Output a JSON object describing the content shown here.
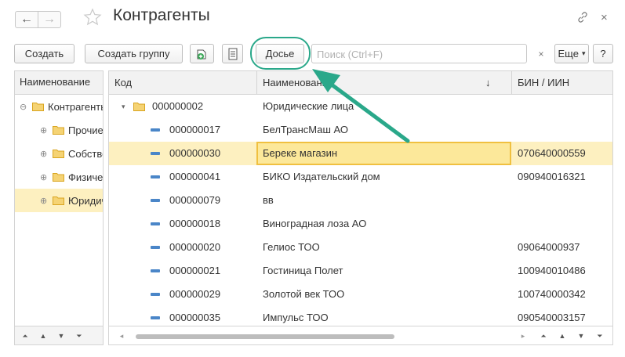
{
  "window": {
    "title": "Контрагенты",
    "back_icon": "←",
    "forward_icon": "→",
    "close_icon": "×"
  },
  "toolbar": {
    "create_label": "Создать",
    "create_group_label": "Создать группу",
    "dossier_label": "Досье",
    "search_placeholder": "Поиск (Ctrl+F)",
    "search_clear": "×",
    "more_label": "Еще",
    "more_arrow": "▾",
    "help_label": "?"
  },
  "tree": {
    "header": "Наименование",
    "items": [
      {
        "label": "Контрагенты",
        "expander": "⊖"
      },
      {
        "label": "Прочие",
        "expander": "⊕"
      },
      {
        "label": "Собственные",
        "expander": "⊕"
      },
      {
        "label": "Физические лица",
        "expander": "⊕"
      },
      {
        "label": "Юридические лица",
        "expander": "⊕"
      }
    ]
  },
  "table": {
    "columns": {
      "code": "Код",
      "name": "Наименование",
      "sort_indicator": "↓",
      "bin": "БИН / ИИН"
    },
    "group_row": {
      "code": "000000002",
      "name": "Юридические лица",
      "expander": "▾"
    },
    "rows": [
      {
        "code": "000000017",
        "name": "БелТрансМаш АО",
        "bin": ""
      },
      {
        "code": "000000030",
        "name": "Береке магазин",
        "bin": "070640000559"
      },
      {
        "code": "000000041",
        "name": "БИКО Издательский дом",
        "bin": "090940016321"
      },
      {
        "code": "000000079",
        "name": "вв",
        "bin": ""
      },
      {
        "code": "000000018",
        "name": "Виноградная лоза АО",
        "bin": ""
      },
      {
        "code": "000000020",
        "name": "Гелиос ТОО",
        "bin": "09064000937"
      },
      {
        "code": "000000021",
        "name": "Гостиница Полет",
        "bin": "100940010486"
      },
      {
        "code": "000000029",
        "name": "Золотой век ТОО",
        "bin": "100740000342"
      },
      {
        "code": "000000035",
        "name": "Импульс ТОО",
        "bin": "090540003157"
      }
    ],
    "selected_index": 1
  },
  "colors": {
    "highlight_ring": "#2aa88a",
    "selected_row": "#fdf0c0",
    "selected_cell": "#fce89a",
    "folder": "#e7b52a",
    "element_dash": "#4a86c8"
  }
}
